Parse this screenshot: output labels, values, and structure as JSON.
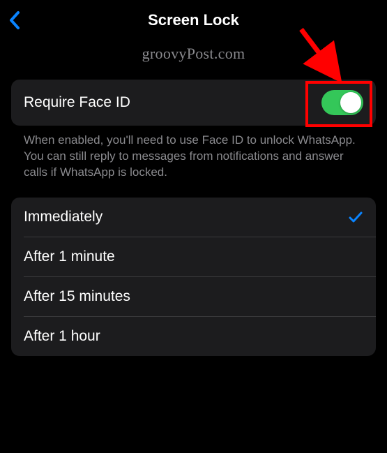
{
  "header": {
    "title": "Screen Lock"
  },
  "watermark": "groovyPost.com",
  "toggle_row": {
    "label": "Require Face ID",
    "enabled": true
  },
  "helper_text": "When enabled, you'll need to use Face ID to unlock WhatsApp. You can still reply to messages from notifications and answer calls if WhatsApp is locked.",
  "timing_options": [
    {
      "label": "Immediately",
      "selected": true
    },
    {
      "label": "After 1 minute",
      "selected": false
    },
    {
      "label": "After 15 minutes",
      "selected": false
    },
    {
      "label": "After 1 hour",
      "selected": false
    }
  ],
  "colors": {
    "accent_blue": "#0a84ff",
    "toggle_on": "#34c759",
    "annotation_red": "#ff0000"
  }
}
